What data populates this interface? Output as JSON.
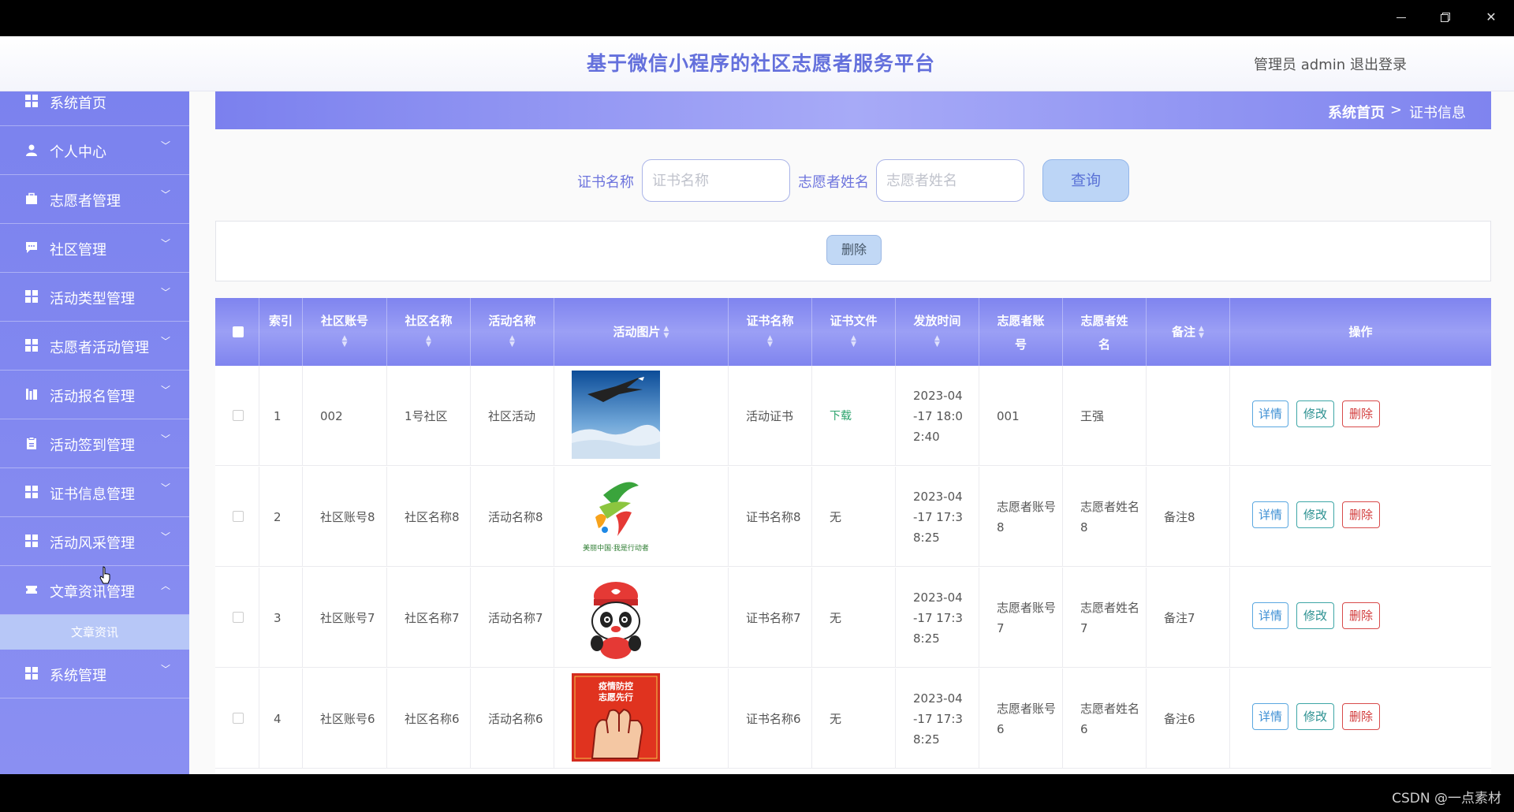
{
  "window": {
    "minimize_icon": "minimize-icon",
    "maximize_icon": "restore-icon",
    "close_icon": "close-icon"
  },
  "header": {
    "title": "基于微信小程序的社区志愿者服务平台",
    "user": "管理员 admin",
    "logout": "退出登录"
  },
  "sidebar": {
    "partial_top_label": "系统首页",
    "items": [
      {
        "label": "个人中心",
        "icon": "user-icon"
      },
      {
        "label": "志愿者管理",
        "icon": "briefcase-icon"
      },
      {
        "label": "社区管理",
        "icon": "chat-icon"
      },
      {
        "label": "活动类型管理",
        "icon": "grid-icon"
      },
      {
        "label": "志愿者活动管理",
        "icon": "grid-icon"
      },
      {
        "label": "活动报名管理",
        "icon": "bar-chart-icon"
      },
      {
        "label": "活动签到管理",
        "icon": "clipboard-icon"
      },
      {
        "label": "证书信息管理",
        "icon": "grid-icon"
      },
      {
        "label": "活动风采管理",
        "icon": "grid-icon"
      },
      {
        "label": "文章资讯管理",
        "icon": "ticket-icon"
      },
      {
        "label": "系统管理",
        "icon": "grid-icon"
      }
    ],
    "sub_item": "文章资讯"
  },
  "breadcrumb": {
    "home": "系统首页",
    "sep": ">",
    "current": "证书信息"
  },
  "search": {
    "cert_label": "证书名称",
    "cert_placeholder": "证书名称",
    "name_label": "志愿者姓名",
    "name_placeholder": "志愿者姓名",
    "query_button": "查询"
  },
  "actions": {
    "delete_button": "删除"
  },
  "table": {
    "headers": {
      "index": "索引",
      "community_account": "社区账号",
      "community_name": "社区名称",
      "activity_name": "活动名称",
      "activity_image": "活动图片",
      "cert_name": "证书名称",
      "cert_file": "证书文件",
      "issue_time": "发放时间",
      "volunteer_account": "志愿者账号",
      "volunteer_name": "志愿者姓名",
      "remark": "备注",
      "operation": "操作"
    },
    "rows": [
      {
        "index": "1",
        "community_account": "002",
        "community_name": "1号社区",
        "activity_name": "社区活动",
        "image": "eagle-over-clouds-image",
        "cert_name": "活动证书",
        "cert_file": "下载",
        "issue_time": "2023-04-17 18:02:40",
        "volunteer_account": "001",
        "volunteer_name": "王强",
        "remark": ""
      },
      {
        "index": "2",
        "community_account": "社区账号8",
        "community_name": "社区名称8",
        "activity_name": "活动名称8",
        "image": "volunteer-logo-image",
        "cert_name": "证书名称8",
        "cert_file": "无",
        "issue_time": "2023-04-17 17:38:25",
        "volunteer_account": "志愿者账号8",
        "volunteer_name": "志愿者姓名8",
        "remark": "备注8"
      },
      {
        "index": "3",
        "community_account": "社区账号7",
        "community_name": "社区名称7",
        "activity_name": "活动名称7",
        "image": "panda-mascot-image",
        "cert_name": "证书名称7",
        "cert_file": "无",
        "issue_time": "2023-04-17 17:38:25",
        "volunteer_account": "志愿者账号7",
        "volunteer_name": "志愿者姓名7",
        "remark": "备注7"
      },
      {
        "index": "4",
        "community_account": "社区账号6",
        "community_name": "社区名称6",
        "activity_name": "活动名称6",
        "image": "epidemic-poster-image",
        "cert_name": "证书名称6",
        "cert_file": "无",
        "issue_time": "2023-04-17 17:38:25",
        "volunteer_account": "志愿者账号6",
        "volunteer_name": "志愿者姓名6",
        "remark": "备注6"
      }
    ],
    "op_labels": {
      "detail": "详情",
      "edit": "修改",
      "delete": "删除"
    },
    "image_poster_text": "疫情防控 志愿先行",
    "image_logo_text": "美丽中国·我是行动者"
  },
  "watermark": "CSDN @一点素材",
  "colors": {
    "accent": "#7b82ee",
    "title": "#6470dc",
    "download": "#2aa36c",
    "danger": "#d23b3b"
  }
}
